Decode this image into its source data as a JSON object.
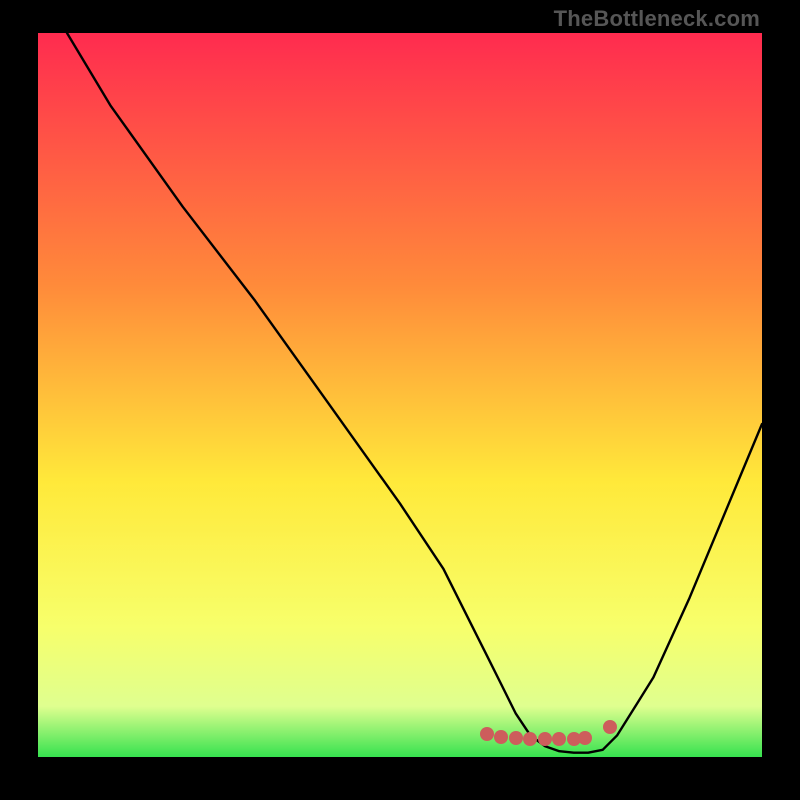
{
  "watermark": "TheBottleneck.com",
  "colors": {
    "background": "#000000",
    "watermark": "#565656",
    "curve": "#000000",
    "marker": "#cd5d5c",
    "gradient_top": "#ff2b4f",
    "gradient_mid_upper": "#ff8b3a",
    "gradient_mid": "#ffe93a",
    "gradient_lower": "#f7ff6b",
    "gradient_near_bottom": "#dfff8f",
    "gradient_bottom": "#36e24f"
  },
  "chart_data": {
    "type": "line",
    "title": "",
    "xlabel": "",
    "ylabel": "",
    "xlim": [
      0,
      100
    ],
    "ylim": [
      0,
      100
    ],
    "grid": false,
    "legend_position": "none",
    "series": [
      {
        "name": "bottleneck-curve",
        "x": [
          4,
          10,
          20,
          30,
          40,
          50,
          56,
          60,
          62,
          64,
          66,
          68,
          70,
          72,
          74,
          76,
          78,
          80,
          85,
          90,
          95,
          100
        ],
        "y": [
          100,
          90,
          76,
          63,
          49,
          35,
          26,
          18,
          14,
          10,
          6,
          3,
          1.5,
          0.8,
          0.6,
          0.6,
          1.0,
          3,
          11,
          22,
          34,
          46
        ]
      }
    ],
    "markers": [
      {
        "name": "flat-region-left",
        "x": 62,
        "y": 3.2
      },
      {
        "name": "flat-region-mid1",
        "x": 64,
        "y": 2.8
      },
      {
        "name": "flat-region-mid2",
        "x": 66,
        "y": 2.6
      },
      {
        "name": "flat-region-mid3",
        "x": 68,
        "y": 2.5
      },
      {
        "name": "flat-region-mid4",
        "x": 70,
        "y": 2.5
      },
      {
        "name": "flat-region-mid5",
        "x": 72,
        "y": 2.5
      },
      {
        "name": "flat-region-mid6",
        "x": 74,
        "y": 2.5
      },
      {
        "name": "flat-region-mid7",
        "x": 75.5,
        "y": 2.6
      },
      {
        "name": "flat-region-right",
        "x": 79,
        "y": 4.2
      }
    ]
  }
}
